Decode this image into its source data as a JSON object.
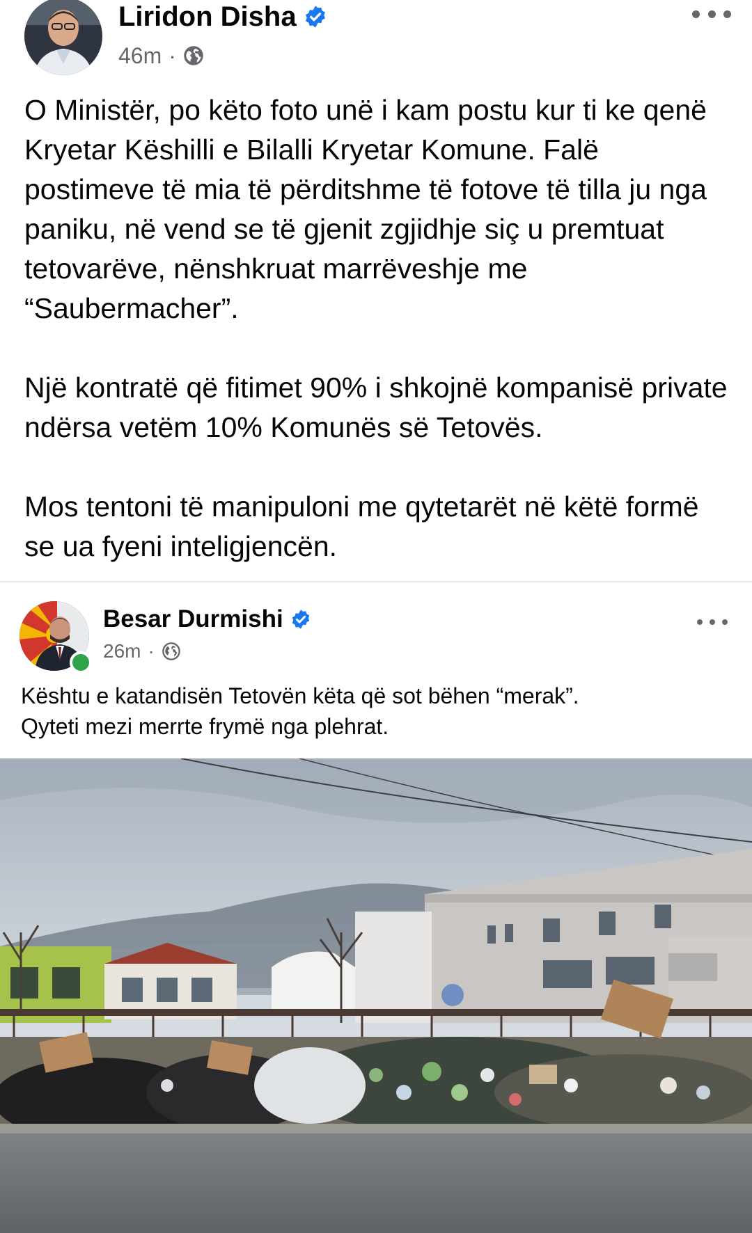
{
  "post": {
    "author": "Liridon Disha",
    "time": "46m",
    "separator": "·",
    "paragraphs": [
      "O Ministër, po këto foto unë i kam postu kur ti ke qenë Kryetar Këshilli e Bilalli Kryetar Komune. Falë postimeve të mia të përditshme të fotove të tilla ju nga paniku, në vend se të gjenit zgjidhje siç u premtuat tetovarëve, nënshkruat marrëveshje me “Saubermacher”.",
      "Një kontratë që fitimet 90% i shkojnë kompanisë private ndërsa vetëm 10% Komunës së Tetovës.",
      "Mos tentoni të manipuloni me qytetarët në këtë formë se ua fyeni inteligjencën."
    ],
    "icons": {
      "verified": "verified-badge-icon",
      "audience": "globe-icon",
      "more": "more-options-icon"
    }
  },
  "shared_post": {
    "author": "Besar Durmishi",
    "time": "26m",
    "separator": "·",
    "text_lines": [
      "Kështu e katandisën Tetovën këta që sot bëhen “merak”.",
      "Qyteti mezi merrte frymë nga plehrat."
    ],
    "online": true,
    "icons": {
      "verified": "verified-badge-icon",
      "audience": "globe-icon",
      "more": "more-options-icon"
    }
  },
  "colors": {
    "text": "#050505",
    "secondary_text": "#65676b",
    "verified_blue": "#1877f2",
    "online_green": "#31a24c",
    "divider": "#e6e7ea"
  }
}
